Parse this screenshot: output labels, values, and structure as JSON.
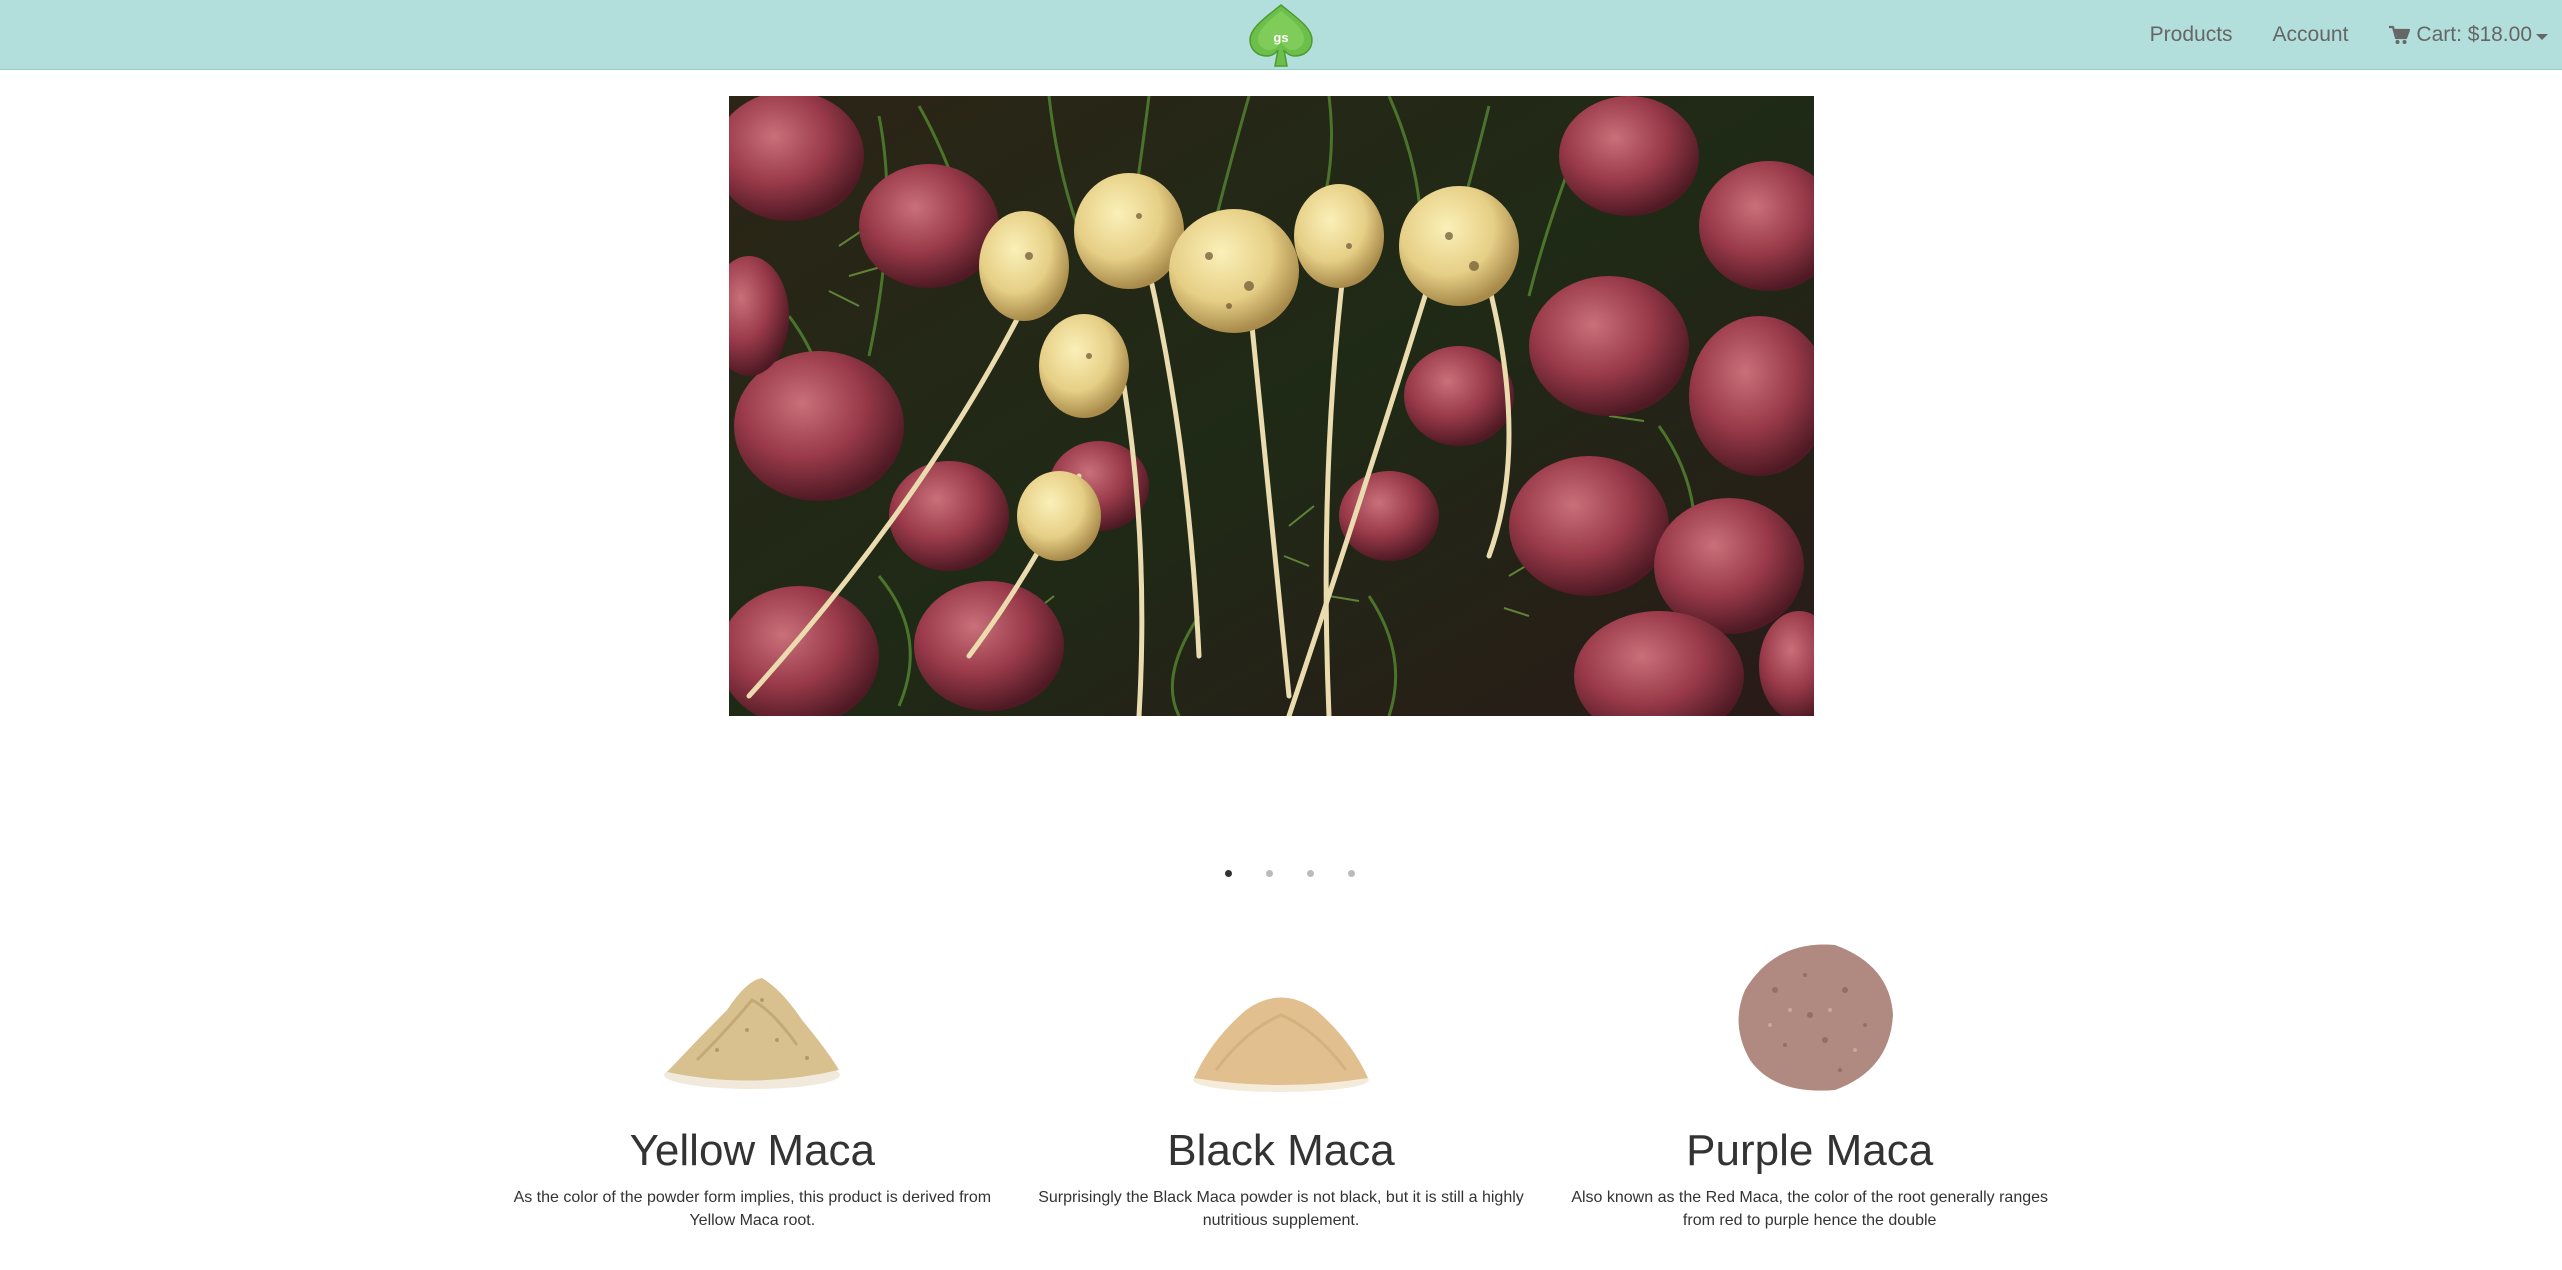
{
  "header": {
    "logo_text": "gs",
    "nav": {
      "products_label": "Products",
      "account_label": "Account",
      "cart_label": "Cart: $18.00"
    }
  },
  "carousel": {
    "slide_alt": "Maca roots",
    "indicator_count": 4,
    "active_index": 0
  },
  "products": [
    {
      "title": "Yellow Maca",
      "description": "As the color of the powder form implies, this product is derived from Yellow Maca root.",
      "powder_color": "#d8c08f"
    },
    {
      "title": "Black Maca",
      "description": "Surprisingly the Black Maca powder is not black, but it is still a highly nutritious supplement.",
      "powder_color": "#e2bf8e"
    },
    {
      "title": "Purple Maca",
      "description": "Also known as the Red Maca, the color of the root generally ranges from red to purple hence the double",
      "powder_color": "#b08a80"
    }
  ],
  "colors": {
    "navbar_bg": "#b2dfdb",
    "nav_text": "#666666",
    "logo_green": "#6cc04a"
  }
}
